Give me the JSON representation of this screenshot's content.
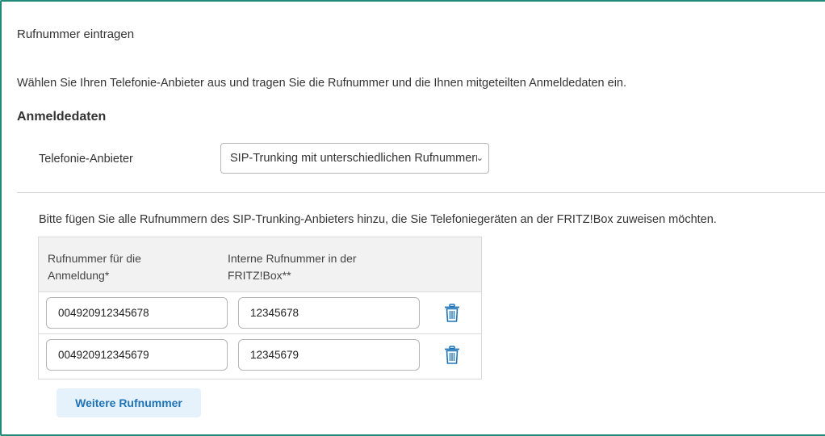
{
  "page": {
    "title": "Rufnummer eintragen",
    "intro": "Wählen Sie Ihren Telefonie-Anbieter aus und tragen Sie die Rufnummer und die Ihnen mitgeteilten Anmeldedaten ein.",
    "section_title": "Anmeldedaten"
  },
  "provider": {
    "label": "Telefonie-Anbieter",
    "selected": "SIP-Trunking mit unterschiedlichen Rufnummern"
  },
  "numbers": {
    "hint": "Bitte fügen Sie alle Rufnummern des SIP-Trunking-Anbieters hinzu, die Sie Telefoniegeräten an der FRITZ!Box zuweisen möchten.",
    "headers": [
      "Rufnummer für die Anmeldung*",
      "Interne Rufnummer in der FRITZ!Box**"
    ],
    "rows": [
      {
        "registration": "004920912345678",
        "internal": "12345678"
      },
      {
        "registration": "004920912345679",
        "internal": "12345679"
      }
    ],
    "add_label": "Weitere Rufnummer"
  },
  "icons": {
    "delete": "trash-icon",
    "dropdown": "chevron-down-icon"
  },
  "colors": {
    "accent": "#1f73b7",
    "frame": "#1f8a78",
    "button_bg": "#e6f2fb"
  }
}
